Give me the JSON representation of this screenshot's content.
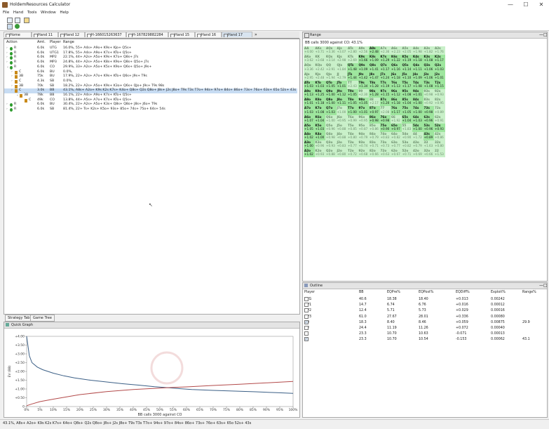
{
  "window": {
    "title": "HoldemResources Calculator",
    "controls": [
      "—",
      "☐",
      "✕"
    ]
  },
  "menu": [
    "File",
    "Hand",
    "Tools",
    "Window",
    "Help"
  ],
  "tabs": [
    "Home",
    "Hand 11",
    "Hand 12",
    "H-166015263637",
    "H-167829882284",
    "Hand 15",
    "Hand 16",
    "Hand 17"
  ],
  "tree": {
    "headers": {
      "action": "Action",
      "amount": "Amt.",
      "player": "Player",
      "range": "Range"
    },
    "rows": [
      {
        "glyph": "›",
        "act": "R",
        "amt": "6.0k",
        "player": "UTG",
        "range": "16.0%, 55+ A4s+ A9o+ K9s+ KJo+ Q5s+"
      },
      {
        "glyph": "›",
        "act": "R",
        "amt": "6.0k",
        "player": "UTG1",
        "range": "17.8%, 55+ A4s+ A9o+ K7s+ KTo+ Q5s+"
      },
      {
        "glyph": "›",
        "act": "R",
        "amt": "6.0k",
        "player": "MP2",
        "range": "22.1%, 44+ A2s+ A5o+ K9s+ K7o+ Q8s+ J7s"
      },
      {
        "glyph": "›",
        "act": "R",
        "amt": "6.0k",
        "player": "MP3",
        "range": "24.8%, 44+ A2s+ A5o+ K8s+ K9o+ Q8s+ Q5o+ J7s"
      },
      {
        "glyph": "⌄",
        "act": "R",
        "amt": "6.0k",
        "player": "CO",
        "range": "29.9%, 33+ A2s+ A5o+ K5s+ K9o+ Q6s+ Q5o+ J9s+"
      },
      {
        "glyph": "›",
        "act": "C",
        "amt": "6.0k",
        "player": "BU",
        "range": "0.0%,"
      },
      {
        "glyph": "›",
        "act": "3B",
        "amt": "75k",
        "player": "BU",
        "range": "17.9%, 22+ A2s+ A7o+ K9s+ KTo+ Q6s+ J9s+ T9s"
      },
      {
        "glyph": "›",
        "act": "C",
        "amt": "4.3k",
        "player": "SB",
        "range": "0.0%,"
      },
      {
        "glyph": "›",
        "act": "3B",
        "amt": "70k",
        "player": "SB",
        "range": "18.2%, 22+ A2s+ A5o+ K9s+ K3o+ Q6s+ QJo+ J9s+ T9s 98s"
      },
      {
        "glyph": "›",
        "act": "C",
        "amt": "3.0k",
        "player": "BB",
        "range": "43.1%, A8s+ A2o+ K9s K2s K7s+ K4o+ Q8s+ Q2s Q8o+ J8s+ J2s J8o+ T9s T3s T7o+ 94s+ 97o+ 84s+ 86o+ 73s+ 76o+ 63s+ 65o 52s+ 43s"
      },
      {
        "glyph": "⌄",
        "act": "3B",
        "amt": "78k",
        "player": "BB",
        "range": "16.1%, 22+ A4s+ A9o+ K7s+ KTo+ Q5s+"
      },
      {
        "glyph": "",
        "act": "C",
        "amt": "49k",
        "player": "CO",
        "range": "13.8%, 44+ A5s+ A7o+ K7s+ KTo+ Q5s+"
      },
      {
        "glyph": "›",
        "act": "R",
        "amt": "6.0k",
        "player": "BU",
        "range": "30.4%, 22+ A2s+ A5o+ K3s+ Q8s+ Q8o+ J8s+ J6o+ T9s"
      },
      {
        "glyph": "›",
        "act": "R",
        "amt": "6.0k",
        "player": "SB",
        "range": "81.4%, 22+ Ts+ K2s+ K5o+ 93s+ 85o+ 74s+ 75o+ 64s+ 54s"
      }
    ]
  },
  "bottom_tabs": [
    "Strategy Table",
    "Game Tree"
  ],
  "range_panel": {
    "title": "Range",
    "subtitle": "BB calls 3000 against CO: 43.1%",
    "cells": [
      [
        [
          "AA",
          "+4.00",
          0
        ],
        [
          "AKs",
          "+3.71",
          0
        ],
        [
          "AQs",
          "+3.36",
          0
        ],
        [
          "AJs",
          "+3.07",
          0
        ],
        [
          "ATs",
          "+2.80",
          0
        ],
        [
          "A9s",
          "+2.56",
          0
        ],
        [
          "A8s",
          "+2.48",
          1
        ],
        [
          "A7s",
          "+2.36",
          0
        ],
        [
          "A6s",
          "+2.23",
          0
        ],
        [
          "A5s",
          "+2.05",
          0
        ],
        [
          "A4s",
          "+1.98",
          0
        ],
        [
          "A3s",
          "+1.82",
          0
        ],
        [
          "A2s",
          "+1.76",
          0
        ]
      ],
      [
        [
          "AKo",
          "+3.62",
          0
        ],
        [
          "KK",
          "+3.68",
          0
        ],
        [
          "KQs",
          "+3.14",
          0
        ],
        [
          "KJs",
          "+2.98",
          0
        ],
        [
          "KTs",
          "+2.69",
          0
        ],
        [
          "K9s",
          "+1.66",
          1
        ],
        [
          "K8s",
          "+1.09",
          1
        ],
        [
          "K7s",
          "+1.29",
          1
        ],
        [
          "K6s",
          "+1.22",
          1
        ],
        [
          "K5s",
          "+1.19",
          1
        ],
        [
          "K4s",
          "+1.18",
          1
        ],
        [
          "K3s",
          "+1.08",
          1
        ],
        [
          "K2s",
          "+1.17",
          1
        ]
      ],
      [
        [
          "AQo",
          "+3.36",
          0
        ],
        [
          "KQo",
          "+2.42",
          0
        ],
        [
          "QQ",
          "+2.91",
          0
        ],
        [
          "QJs",
          "+1.84",
          0
        ],
        [
          "QTs",
          "+1.48",
          1
        ],
        [
          "Q9s",
          "+1.09",
          1
        ],
        [
          "Q8s",
          "+1.41",
          1
        ],
        [
          "Q7s",
          "+1.17",
          1
        ],
        [
          "Q6s",
          "+1.16",
          1
        ],
        [
          "Q5s",
          "+1.14",
          1
        ],
        [
          "Q4s",
          "+1.11",
          1
        ],
        [
          "Q3s",
          "+1.06",
          1
        ],
        [
          "Q2s",
          "+1.03",
          1
        ]
      ],
      [
        [
          "AJo",
          "+2.95",
          0
        ],
        [
          "KJo",
          "+2.48",
          0
        ],
        [
          "QJo",
          "+1.94",
          0
        ],
        [
          "JJ",
          "+2.79",
          0
        ],
        [
          "JTs",
          "+1.44",
          1
        ],
        [
          "J9s",
          "+1.42",
          1
        ],
        [
          "J8s",
          "+1.47",
          1
        ],
        [
          "J7s",
          "+1.24",
          1
        ],
        [
          "J6s",
          "+1.18",
          1
        ],
        [
          "J5s",
          "+1.10",
          1
        ],
        [
          "J4s",
          "+1.09",
          1
        ],
        [
          "J3s",
          "+1.06",
          1
        ],
        [
          "J2s",
          "+1.01",
          1
        ]
      ],
      [
        [
          "ATo",
          "+1.03",
          1
        ],
        [
          "KTo",
          "+1.03",
          1
        ],
        [
          "QTo",
          "+1.05",
          1
        ],
        [
          "JTo",
          "+1.01",
          1
        ],
        [
          "TT",
          "+2.43",
          0
        ],
        [
          "T9s",
          "+1.34",
          1
        ],
        [
          "T8s",
          "+1.28",
          1
        ],
        [
          "T7s",
          "+1.19",
          1
        ],
        [
          "T6s",
          "+1.13",
          1
        ],
        [
          "T5s",
          "+1.17",
          1
        ],
        [
          "T4s",
          "+1.08",
          1
        ],
        [
          "T3s",
          "+1.08",
          1
        ],
        [
          "T2s",
          "+1.15",
          1
        ]
      ],
      [
        [
          "A9o",
          "+1.13",
          1
        ],
        [
          "K9o",
          "+1.25",
          1
        ],
        [
          "Q9o",
          "+1.00",
          1
        ],
        [
          "J9o",
          "+1.12",
          1
        ],
        [
          "T9o",
          "+1.05",
          1
        ],
        [
          "99",
          "+2.30",
          0
        ],
        [
          "98s",
          "+1.28",
          1
        ],
        [
          "97s",
          "+1.15",
          1
        ],
        [
          "96s",
          "+1.12",
          1
        ],
        [
          "95s",
          "+1.08",
          1
        ],
        [
          "94s",
          "+1.01",
          1
        ],
        [
          "93s",
          "+0.98",
          0
        ],
        [
          "92s",
          "+0.93",
          0
        ]
      ],
      [
        [
          "A8o",
          "+1.01",
          1
        ],
        [
          "K8o",
          "+1.18",
          1
        ],
        [
          "Q8o",
          "+1.00",
          1
        ],
        [
          "J8o",
          "+1.11",
          1
        ],
        [
          "T8o",
          "+1.05",
          1
        ],
        [
          "98o",
          "+1.05",
          1
        ],
        [
          "88",
          "+2.17",
          0
        ],
        [
          "87s",
          "+1.20",
          1
        ],
        [
          "86s",
          "+1.18",
          1
        ],
        [
          "85s",
          "+1.04",
          1
        ],
        [
          "84s",
          "+1.00",
          1
        ],
        [
          "83s",
          "+0.92",
          0
        ],
        [
          "82s",
          "+0.95",
          0
        ]
      ],
      [
        [
          "A7o",
          "+1.03",
          1
        ],
        [
          "K7o",
          "+1.08",
          1
        ],
        [
          "Q7o",
          "+1.03",
          1
        ],
        [
          "J7o",
          "+1.00",
          0
        ],
        [
          "T7o",
          "+1.00",
          1
        ],
        [
          "97o",
          "+1.01",
          1
        ],
        [
          "87o",
          "+0.97",
          1
        ],
        [
          "77",
          "+2.08",
          0
        ],
        [
          "76s",
          "+1.17",
          1
        ],
        [
          "75s",
          "+1.05",
          1
        ],
        [
          "74s",
          "+1.00",
          1
        ],
        [
          "73s",
          "+0.98",
          1
        ],
        [
          "72s",
          "+0.89",
          0
        ]
      ],
      [
        [
          "A6o",
          "+1.07",
          1
        ],
        [
          "K6o",
          "+1.04",
          1
        ],
        [
          "Q6o",
          "+1.00",
          0
        ],
        [
          "J6o",
          "+0.95",
          0
        ],
        [
          "T6o",
          "+0.99",
          0
        ],
        [
          "96o",
          "+0.95",
          0
        ],
        [
          "86o",
          "+0.98",
          1
        ],
        [
          "76o",
          "+0.98",
          1
        ],
        [
          "66",
          "+1.92",
          0
        ],
        [
          "65s",
          "+1.04",
          1
        ],
        [
          "64s",
          "+1.03",
          1
        ],
        [
          "63s",
          "+0.96",
          1
        ],
        [
          "62s",
          "+0.91",
          0
        ]
      ],
      [
        [
          "A5o",
          "+1.05",
          1
        ],
        [
          "K5o",
          "+1.03",
          1
        ],
        [
          "Q5o",
          "+0.96",
          0
        ],
        [
          "J5o",
          "+0.88",
          0
        ],
        [
          "T5o",
          "+0.85",
          0
        ],
        [
          "95o",
          "+0.87",
          0
        ],
        [
          "85o",
          "+0.86",
          0
        ],
        [
          "75o",
          "+0.90",
          1
        ],
        [
          "65o",
          "+0.97",
          1
        ],
        [
          "55",
          "+1.83",
          0
        ],
        [
          "54s",
          "+1.00",
          1
        ],
        [
          "53s",
          "+0.96",
          1
        ],
        [
          "52s",
          "+0.93",
          1
        ]
      ],
      [
        [
          "A4o",
          "+1.02",
          1
        ],
        [
          "K4o",
          "+1.00",
          1
        ],
        [
          "Q4o",
          "+0.98",
          0
        ],
        [
          "J4o",
          "+0.88",
          0
        ],
        [
          "T4o",
          "+0.80",
          0
        ],
        [
          "94o",
          "+0.79",
          0
        ],
        [
          "84o",
          "+0.79",
          0
        ],
        [
          "74o",
          "+0.83",
          0
        ],
        [
          "64o",
          "+0.82",
          0
        ],
        [
          "54o",
          "+0.90",
          0
        ],
        [
          "44",
          "+1.72",
          0
        ],
        [
          "43s",
          "+0.89",
          1
        ],
        [
          "42s",
          "+0.86",
          0
        ]
      ],
      [
        [
          "A3o",
          "+1.00",
          1
        ],
        [
          "K3o",
          "+0.96",
          0
        ],
        [
          "Q3o",
          "+0.93",
          0
        ],
        [
          "J3o",
          "+0.83",
          0
        ],
        [
          "T3o",
          "+0.77",
          0
        ],
        [
          "93o",
          "+0.74",
          0
        ],
        [
          "83o",
          "+0.71",
          0
        ],
        [
          "73o",
          "+0.73",
          0
        ],
        [
          "63o",
          "+0.77",
          0
        ],
        [
          "53o",
          "+0.82",
          0
        ],
        [
          "43o",
          "+0.79",
          0
        ],
        [
          "33",
          "+1.63",
          0
        ],
        [
          "32s",
          "+0.80",
          0
        ]
      ],
      [
        [
          "A2o",
          "+1.02",
          1
        ],
        [
          "K2o",
          "+0.93",
          0
        ],
        [
          "Q2o",
          "+0.88",
          0
        ],
        [
          "J2o",
          "+0.80",
          0
        ],
        [
          "T2o",
          "+0.72",
          0
        ],
        [
          "92o",
          "+0.68",
          0
        ],
        [
          "82o",
          "+0.66",
          0
        ],
        [
          "72o",
          "+0.63",
          0
        ],
        [
          "62o",
          "+0.67",
          0
        ],
        [
          "52o",
          "+0.71",
          0
        ],
        [
          "42o",
          "+0.69",
          0
        ],
        [
          "32o",
          "+0.66",
          0
        ],
        [
          "22",
          "+1.53",
          0
        ]
      ]
    ]
  },
  "outline": {
    "title": "Outline",
    "headers": [
      "Player",
      "BB",
      "EQPre%",
      "EQPost%",
      "EQDiff%",
      "Exploit%",
      "Range%"
    ],
    "rows": [
      {
        "checked": false,
        "player": "UTG",
        "bb": "40.6",
        "eqpre": "18.38",
        "eqpost": "18.40",
        "eqdiff": "+0.013",
        "exploit": "0.00242",
        "range": ""
      },
      {
        "checked": false,
        "player": "MP1",
        "bb": "14.7",
        "eqpre": "6.74",
        "eqpost": "6.76",
        "eqdiff": "+0.016",
        "exploit": "0.00012",
        "range": ""
      },
      {
        "checked": false,
        "player": "MP2",
        "bb": "12.4",
        "eqpre": "5.71",
        "eqpost": "5.73",
        "eqdiff": "+0.029",
        "exploit": "0.00016",
        "range": ""
      },
      {
        "checked": false,
        "player": "MP3",
        "bb": "61.0",
        "eqpre": "27.67",
        "eqpost": "28.01",
        "eqdiff": "+0.336",
        "exploit": "0.00080",
        "range": ""
      },
      {
        "checked": true,
        "player": "CO",
        "bb": "18.3",
        "eqpre": "8.40",
        "eqpost": "8.46",
        "eqdiff": "+0.059",
        "exploit": "0.00875",
        "range": "29.9"
      },
      {
        "checked": false,
        "player": "BU",
        "bb": "24.4",
        "eqpre": "11.19",
        "eqpost": "11.26",
        "eqdiff": "+0.072",
        "exploit": "0.00040",
        "range": ""
      },
      {
        "checked": false,
        "player": "SB",
        "bb": "23.3",
        "eqpre": "10.70",
        "eqpost": "10.63",
        "eqdiff": "-0.071",
        "exploit": "0.00013",
        "range": ""
      },
      {
        "checked": true,
        "player": "BB",
        "bb": "23.3",
        "eqpre": "10.70",
        "eqpost": "10.54",
        "eqdiff": "-0.153",
        "exploit": "0.00062",
        "range": "43.1"
      }
    ]
  },
  "quick_graph": {
    "title": "Quick Graph",
    "ylabel": "EV (BB)",
    "xlabel": "BB calls 3000 against CO"
  },
  "chart_data": {
    "type": "line",
    "ylabel": "EV (BB)",
    "xlabel": "BB calls 3000 against CO",
    "ylim": [
      0,
      4.0
    ],
    "xlim": [
      0,
      100
    ],
    "y_ticks": [
      "+4.00",
      "+3.50",
      "+3.00",
      "+2.50",
      "+2.00",
      "+1.50",
      "+1.00",
      "+0.50",
      "0"
    ],
    "x_ticks": [
      "0%",
      "5%",
      "10%",
      "15%",
      "20%",
      "25%",
      "30%",
      "35%",
      "40%",
      "45%",
      "50%",
      "55%",
      "60%",
      "65%",
      "70%",
      "75%",
      "80%",
      "85%",
      "90%",
      "95%",
      "100%"
    ],
    "series": [
      {
        "color": "#3b5f86",
        "x": [
          0,
          1,
          2,
          4,
          6,
          8,
          10,
          14,
          18,
          24,
          30,
          36,
          42,
          48,
          55,
          62,
          70,
          78,
          86,
          94,
          100
        ],
        "y": [
          4.0,
          2.9,
          2.5,
          2.25,
          2.1,
          2.0,
          1.9,
          1.75,
          1.63,
          1.5,
          1.4,
          1.3,
          1.22,
          1.13,
          1.05,
          0.97,
          0.92,
          0.88,
          0.84,
          0.79,
          0.75
        ]
      },
      {
        "color": "#b34a4a",
        "x": [
          0,
          2,
          5,
          10,
          15,
          20,
          30,
          40,
          50,
          55,
          60,
          70,
          80,
          90,
          100
        ],
        "y": [
          0.05,
          0.15,
          0.28,
          0.42,
          0.55,
          0.68,
          0.85,
          0.97,
          1.05,
          1.09,
          1.12,
          1.2,
          1.27,
          1.35,
          1.43
        ]
      }
    ]
  },
  "status": {
    "text": "43.1%, A8s+ A2o+ K9s K2s K7s+ K4o+ Q8s+ Q2s Q8o+ J8s+ J2s J8o+ T9s T3s T7o+ 94s+ 97o+ 84s+ 86o+ 73s+ 76o+ 63s+ 65o 52s+ 43s"
  },
  "colors": {
    "range_in": "#9ee69e",
    "range_out": "#c9f0c9",
    "selection": "#c7dcf3"
  }
}
